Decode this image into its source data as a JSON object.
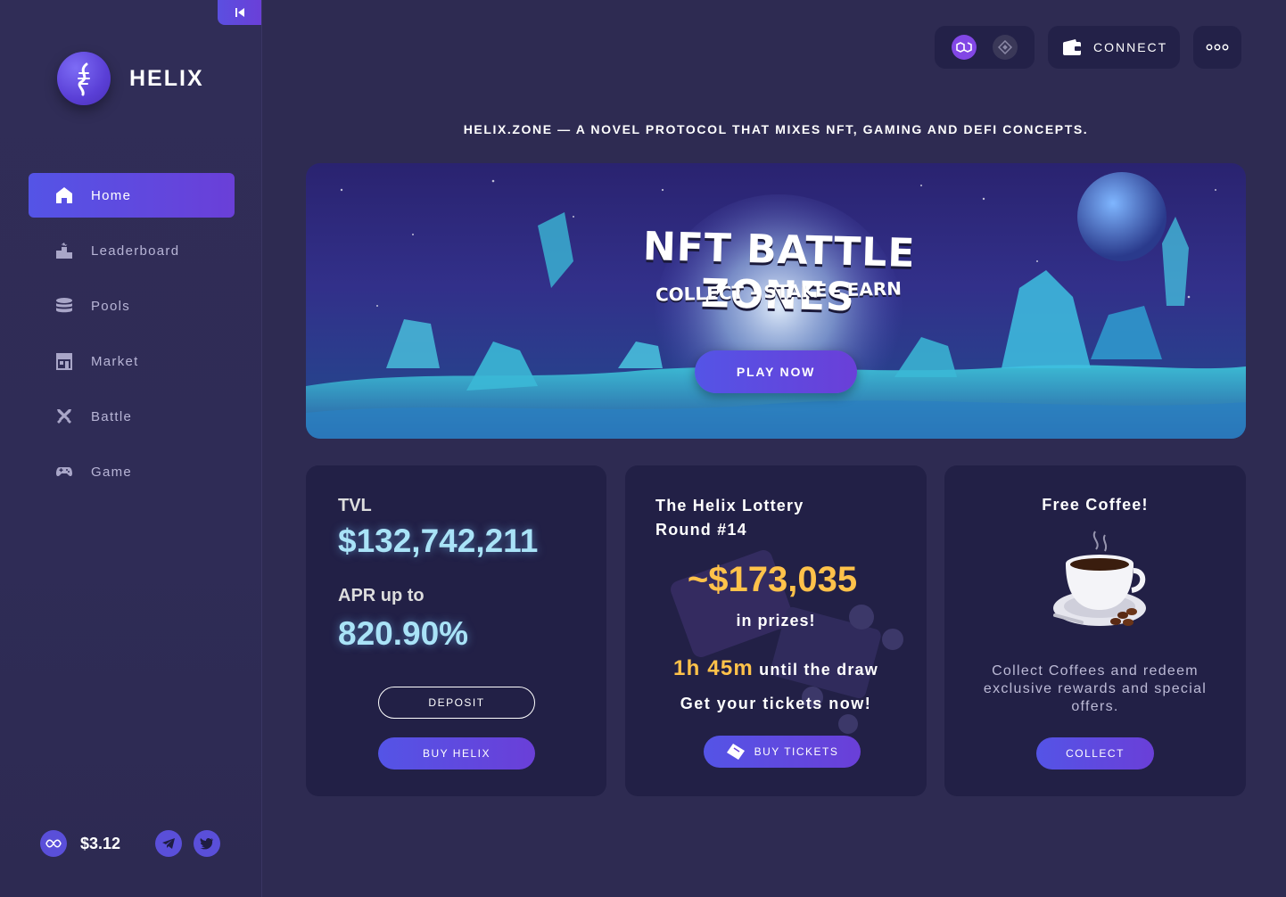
{
  "app": {
    "name": "HELIX",
    "collapse_icon": "collapse-left-icon"
  },
  "sidebar": {
    "items": [
      {
        "label": "Home",
        "icon": "home-icon",
        "active": true
      },
      {
        "label": "Leaderboard",
        "icon": "leaderboard-icon",
        "active": false
      },
      {
        "label": "Pools",
        "icon": "coins-stack-icon",
        "active": false
      },
      {
        "label": "Market",
        "icon": "market-store-icon",
        "active": false
      },
      {
        "label": "Battle",
        "icon": "crossed-swords-icon",
        "active": false
      },
      {
        "label": "Game",
        "icon": "gamepad-icon",
        "active": false
      }
    ],
    "footer": {
      "token_price": "$3.12",
      "token_icon": "helix-token-icon",
      "socials": [
        "telegram-icon",
        "twitter-icon"
      ]
    }
  },
  "topbar": {
    "chains": [
      "polygon-icon",
      "bnb-icon"
    ],
    "connect_label": "CONNECT",
    "connect_icon": "wallet-icon",
    "more_icon": "more-dots-icon"
  },
  "tagline": "HELIX.ZONE — A NOVEL PROTOCOL THAT MIXES NFT, GAMING AND DEFI CONCEPTS.",
  "banner": {
    "title": "NFT BATTLE ZONES",
    "subtitle": "COLLECT - STAKE - EARN",
    "cta": "PLAY NOW"
  },
  "cards": {
    "tvl": {
      "label": "TVL",
      "value": "$132,742,211",
      "apr_label": "APR up to",
      "apr_value": "820.90%",
      "deposit_label": "DEPOSIT",
      "buy_label": "BUY HELIX"
    },
    "lottery": {
      "title_line1": "The Helix Lottery",
      "title_line2": "Round #14",
      "amount": "~$173,035",
      "prizes_text": "in prizes!",
      "time_value": "1h 45m",
      "time_suffix": "until the draw",
      "cta_text": "Get your tickets now!",
      "buy_label": "BUY TICKETS",
      "buy_icon": "ticket-icon"
    },
    "coffee": {
      "title": "Free Coffee!",
      "image_icon": "coffee-cup-icon",
      "description": "Collect Coffees and redeem exclusive rewards and special offers.",
      "collect_label": "COLLECT"
    }
  },
  "colors": {
    "background": "#2e2b52",
    "card": "#222046",
    "accent_start": "#5454e6",
    "accent_end": "#6a3fd8",
    "tvl_value": "#a9e3f7",
    "lottery_gold": "#ffc24a"
  }
}
